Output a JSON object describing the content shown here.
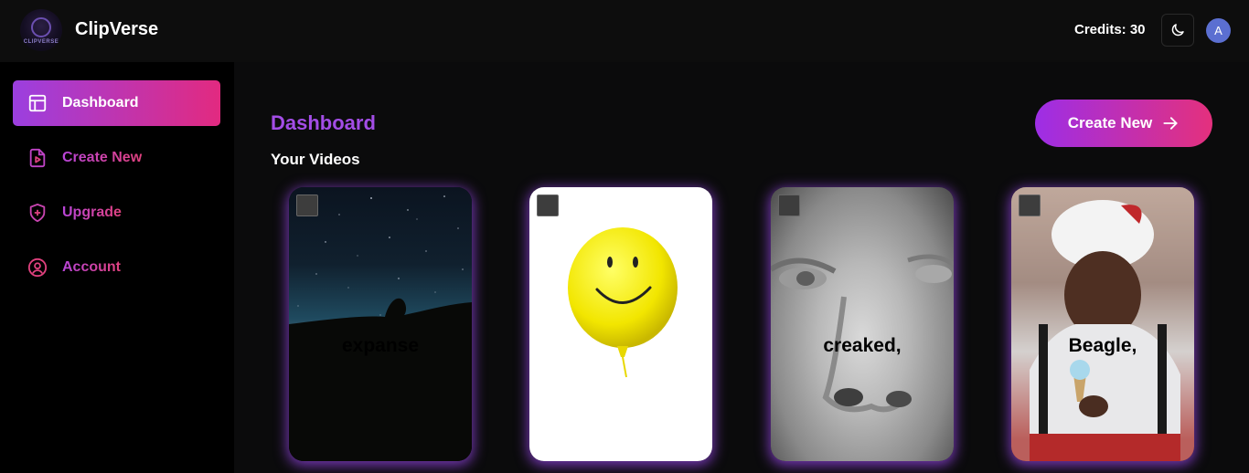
{
  "header": {
    "app_title": "ClipVerse",
    "logo_text": "CLIPVERSE",
    "credits_label": "Credits: 30",
    "avatar_initial": "A"
  },
  "sidebar": {
    "items": [
      {
        "label": "Dashboard",
        "icon": "layout-icon",
        "active": true
      },
      {
        "label": "Create New",
        "icon": "file-video-icon",
        "active": false
      },
      {
        "label": "Upgrade",
        "icon": "shield-plus-icon",
        "active": false
      },
      {
        "label": "Account",
        "icon": "user-circle-icon",
        "active": false
      }
    ]
  },
  "main": {
    "title": "Dashboard",
    "section_title": "Your Videos",
    "create_button_label": "Create New",
    "videos": [
      {
        "caption": "expanse",
        "thumbnail": "night-sky-silhouette"
      },
      {
        "caption": "",
        "thumbnail": "yellow-smiley-balloon"
      },
      {
        "caption": "creaked,",
        "thumbnail": "statue-face"
      },
      {
        "caption": "Beagle,",
        "thumbnail": "man-santa-hat"
      }
    ]
  },
  "colors": {
    "accent_purple": "#9b3fe0",
    "accent_pink": "#e22a80",
    "title_purple": "#a34de6",
    "background": "#0b0b0c"
  }
}
